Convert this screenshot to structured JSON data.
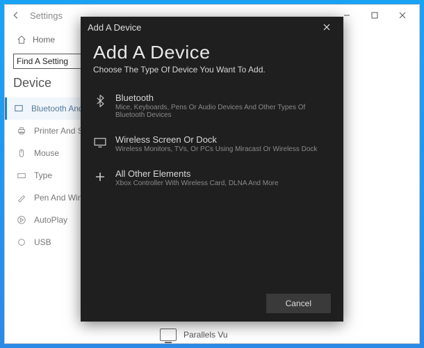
{
  "settings": {
    "title": "Settings",
    "home": "Home",
    "searchPlaceholder": "Find A Setting",
    "sectionHeading": "Device",
    "nav": [
      {
        "label": "Bluetooth And Others d"
      },
      {
        "label": "Printer And Scanner"
      },
      {
        "label": "Mouse"
      },
      {
        "label": "Type"
      },
      {
        "label": "Pen And Windows"
      },
      {
        "label": "AutoPlay"
      },
      {
        "label": "USB"
      }
    ]
  },
  "modal": {
    "windowTitle": "Add A Device",
    "heading": "Add A Device",
    "subheading": "Choose The Type Of Device You Want To Add.",
    "options": [
      {
        "title": "Bluetooth",
        "desc": "Mice, Keyboards, Pens Or Audio Devices And Other Types Of Bluetooth Devices"
      },
      {
        "title": "Wireless Screen Or Dock",
        "desc": "Wireless Monitors, TVs, Or PCs Using Miracast Or Wireless Dock"
      },
      {
        "title": "All Other Elements",
        "desc": "Xbox Controller With Wireless Card, DLNA And More"
      }
    ],
    "cancel": "Cancel"
  },
  "bottomDevice": "Parallels Vu"
}
